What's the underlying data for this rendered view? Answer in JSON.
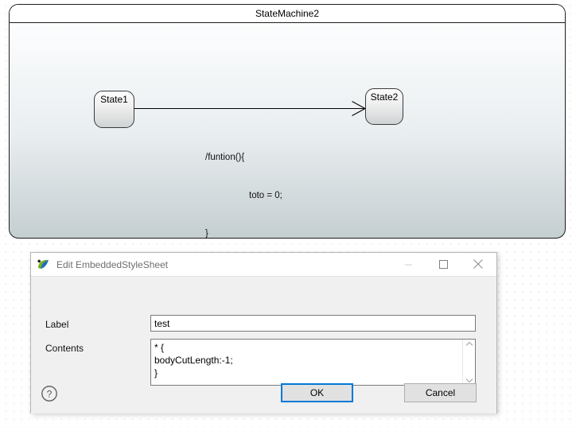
{
  "diagram": {
    "frame_title": "StateMachine2",
    "states": [
      {
        "name": "State1"
      },
      {
        "name": "State2"
      }
    ],
    "transition": {
      "line1": "/funtion(){",
      "line2": "toto = 0;",
      "line3": "}"
    }
  },
  "dialog": {
    "title": "Edit EmbeddedStyleSheet",
    "app_icon": "papyrus-logo-icon",
    "window_controls": {
      "minimize": "minimize-icon",
      "maximize": "maximize-icon",
      "close": "close-icon"
    },
    "fields": {
      "label_caption": "Label",
      "label_value": "test",
      "label_placeholder": "",
      "contents_caption": "Contents",
      "contents_value": "* {\nbodyCutLength:-1;\n}",
      "contents_placeholder": ""
    },
    "scrollbar": {
      "up": "scroll-up-icon",
      "down": "scroll-down-icon"
    },
    "footer": {
      "help": "help-icon",
      "ok_label": "OK",
      "cancel_label": "Cancel"
    }
  },
  "colors": {
    "accent": "#0078d7",
    "dialog_bg": "#f0f0f0",
    "titlebar_bg": "#ffffff",
    "frame_border": "#1d1d1d",
    "logo_green": "#7ab317",
    "logo_blue": "#1f6fb0"
  }
}
